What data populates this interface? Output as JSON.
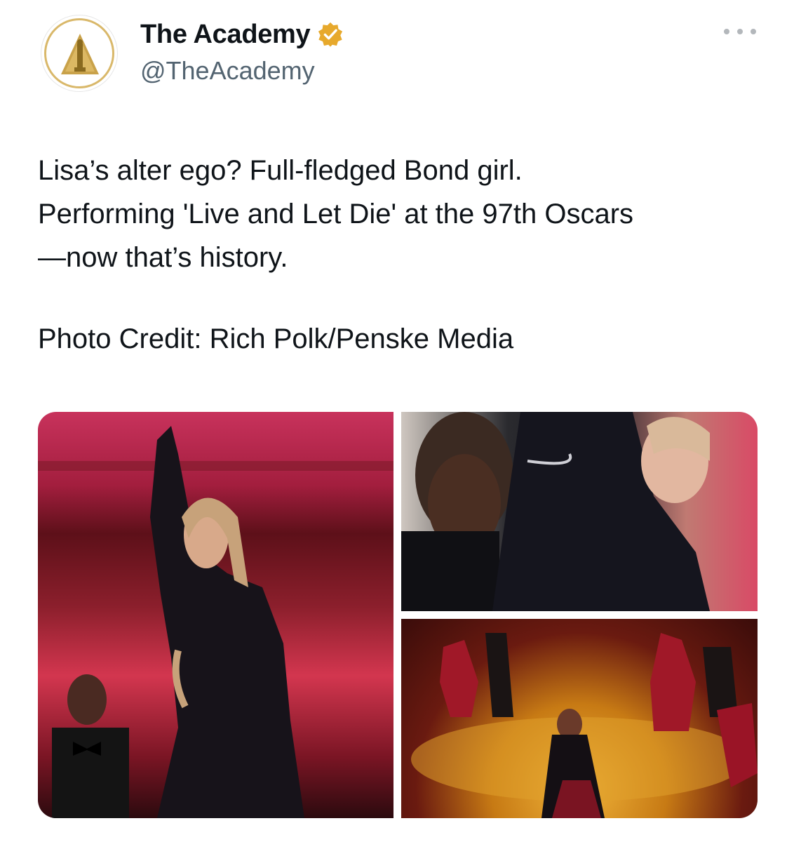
{
  "author": {
    "display_name": "The Academy",
    "handle": "@TheAcademy",
    "verified": true,
    "badge_color": "#e7a92c",
    "avatar_accent": "#d9b86a"
  },
  "menu": {
    "icon": "more-horizontal-icon"
  },
  "tweet": {
    "paragraph_1": "Lisa’s alter ego? Full-fledged Bond girl.\nPerforming 'Live and Let Die' at the 97th Oscars\n—now that’s history.",
    "paragraph_2": "Photo Credit: Rich Polk/Penske Media"
  },
  "media": {
    "count": 3,
    "photos": [
      {
        "subject": "performer-dancing-photo"
      },
      {
        "subject": "dress-closeup-photo"
      },
      {
        "subject": "stage-dancers-photo"
      }
    ]
  }
}
